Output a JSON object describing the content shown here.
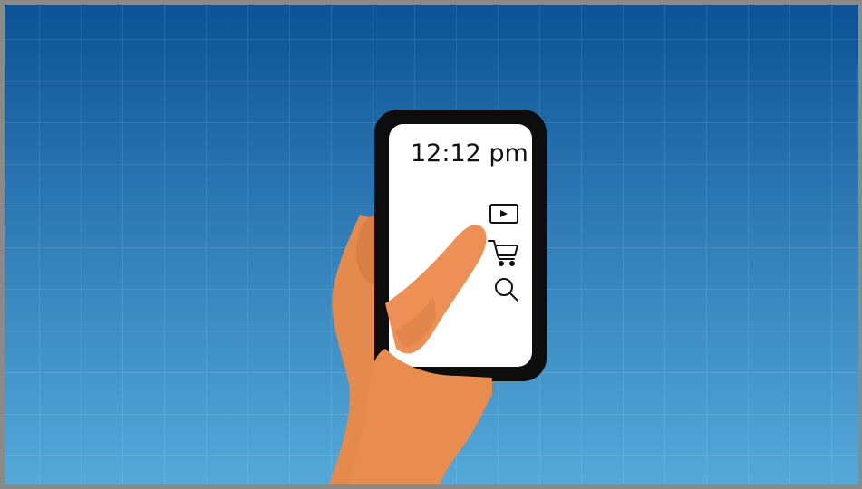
{
  "phone": {
    "clock_text": "12:12 pm",
    "screen_icons": [
      "play-video-icon",
      "shopping-cart-icon",
      "search-icon"
    ]
  },
  "colors": {
    "sky_top": "#0b5394",
    "sky_bottom": "#54a9d8",
    "phone_body": "#0d0d0d",
    "screen": "#ffffff",
    "skin": "#e98c4f",
    "frame_border": "#8a8a8a"
  }
}
